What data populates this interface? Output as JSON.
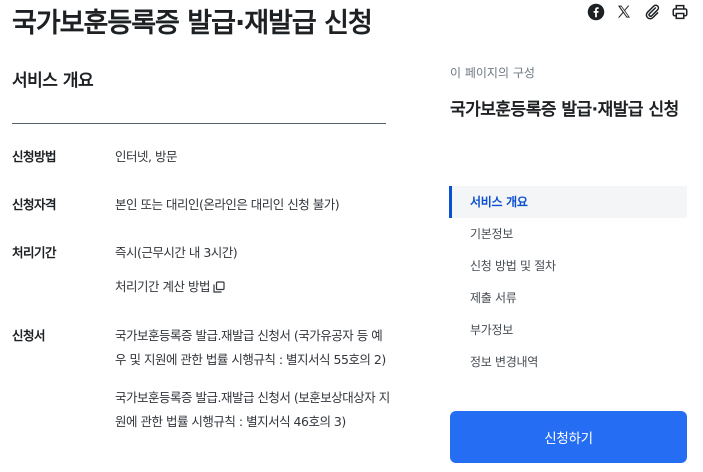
{
  "page": {
    "title": "국가보훈등록증 발급·재발급 신청"
  },
  "share": {
    "icons": [
      "facebook-icon",
      "x-icon",
      "link-icon",
      "print-icon"
    ]
  },
  "overview": {
    "title": "서비스 개요",
    "rows": [
      {
        "label": "신청방법",
        "values": [
          "인터넷, 방문"
        ]
      },
      {
        "label": "신청자격",
        "values": [
          "본인 또는 대리인(온라인은 대리인 신청 불가)"
        ]
      },
      {
        "label": "처리기간",
        "values": [
          "즉시(근무시간 내 3시간)"
        ],
        "link": "처리기간 계산 방법"
      },
      {
        "label": "신청서",
        "values": [
          "국가보훈등록증 발급.재발급 신청서 (국가유공자 등 예우 및 지원에 관한 법률 시행규칙 : 별지서식 55호의 2)",
          "국가보훈등록증 발급.재발급 신청서 (보훈보상대상자 지원에 관한 법률 시행규칙 : 별지서식 46호의 3)"
        ]
      }
    ]
  },
  "toc": {
    "caption": "이 페이지의 구성",
    "title": "국가보훈등록증 발급·재발급 신청",
    "items": [
      "서비스 개요",
      "기본정보",
      "신청 방법 및 절차",
      "제출 서류",
      "부가정보",
      "정보 변경내역"
    ],
    "active_index": 0
  },
  "apply_button": {
    "label": "신청하기",
    "color": "#256ef4"
  },
  "colors": {
    "accent": "#0b50d0",
    "text": "#1e2124"
  }
}
